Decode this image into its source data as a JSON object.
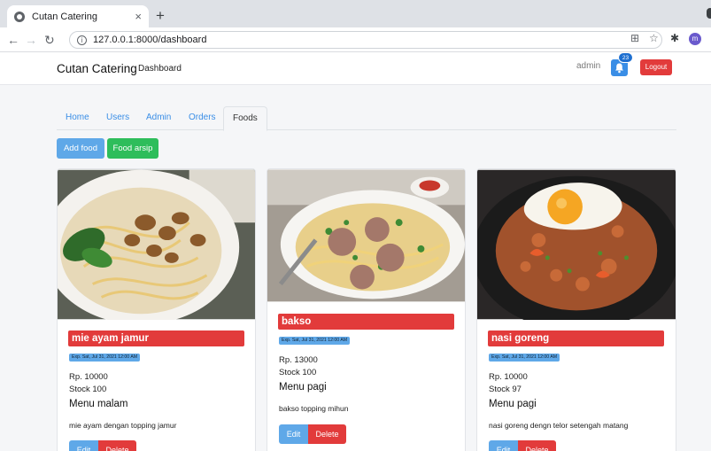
{
  "browser": {
    "tab_title": "Cutan Catering",
    "tab_close": "×",
    "new_tab": "+",
    "url": "127.0.0.1:8000/dashboard",
    "profile_initial": "m"
  },
  "navbar": {
    "brand": "Cutan Catering",
    "dashboard_link": "Dashboard",
    "user": "admin",
    "notification_count": "23",
    "logout_label": "Logout"
  },
  "tabs": {
    "home": "Home",
    "users": "Users",
    "admin": "Admin",
    "orders": "Orders",
    "foods": "Foods"
  },
  "actions": {
    "add_food": "Add food",
    "food_archive": "Food arsip"
  },
  "foods": [
    {
      "name": "mie ayam jamur",
      "exp": "Exp. Sat, Jul 31, 2021 12:00 AM",
      "price": "Rp. 10000",
      "stock": "Stock 100",
      "menu": "Menu malam",
      "description": "mie ayam dengan topping jamur",
      "edit_label": "Edit",
      "delete_label": "Delete"
    },
    {
      "name": "bakso",
      "exp": "Exp. Sat, Jul 31, 2021 12:00 AM",
      "price": "Rp. 13000",
      "stock": "Stock 100",
      "menu": "Menu pagi",
      "description": "bakso topping mihun",
      "edit_label": "Edit",
      "delete_label": "Delete"
    },
    {
      "name": "nasi goreng",
      "exp": "Exp. Sat, Jul 31, 2021 12:00 AM",
      "price": "Rp. 10000",
      "stock": "Stock 97",
      "menu": "Menu pagi",
      "description": "nasi goreng dengn telor setengah matang",
      "edit_label": "Edit",
      "delete_label": "Delete"
    }
  ],
  "colors": {
    "primary": "#3a8ee6",
    "success": "#2ebd5b",
    "danger": "#e23b3b",
    "info": "#5fa8e8"
  }
}
